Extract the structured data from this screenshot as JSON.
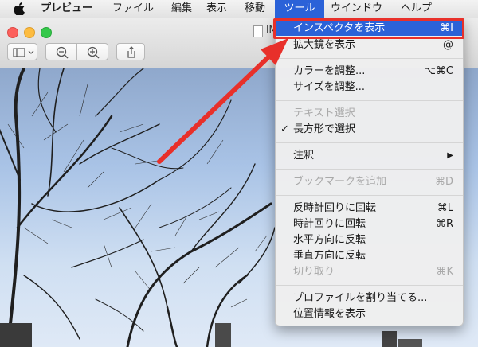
{
  "menubar": {
    "app": "プレビュー",
    "items": [
      "ファイル",
      "編集",
      "表示",
      "移動",
      "ツール",
      "ウインドウ",
      "ヘルプ"
    ]
  },
  "window": {
    "title": "IM"
  },
  "tools_menu": {
    "inspector": {
      "label": "インスペクタを表示",
      "shortcut": "⌘I"
    },
    "magnifier": {
      "label": "拡大鏡を表示",
      "shortcut": "@"
    },
    "adjust_color": {
      "label": "カラーを調整...",
      "shortcut": "⌥⌘C"
    },
    "adjust_size": {
      "label": "サイズを調整..."
    },
    "text_select": {
      "label": "テキスト選択"
    },
    "rect_select": {
      "label": "長方形で選択",
      "check": "✓"
    },
    "annotate": {
      "label": "注釈",
      "arrow": "▶"
    },
    "bookmark": {
      "label": "ブックマークを追加",
      "shortcut": "⌘D"
    },
    "rotate_left": {
      "label": "反時計回りに回転",
      "shortcut": "⌘L"
    },
    "rotate_right": {
      "label": "時計回りに回転",
      "shortcut": "⌘R"
    },
    "flip_h": {
      "label": "水平方向に反転"
    },
    "flip_v": {
      "label": "垂直方向に反転"
    },
    "crop": {
      "label": "切り取り",
      "shortcut": "⌘K"
    },
    "assign_profile": {
      "label": "プロファイルを割り当てる..."
    },
    "location": {
      "label": "位置情報を表示"
    }
  },
  "colors": {
    "highlight": "#2b62d8",
    "annotation": "#e8302a"
  }
}
